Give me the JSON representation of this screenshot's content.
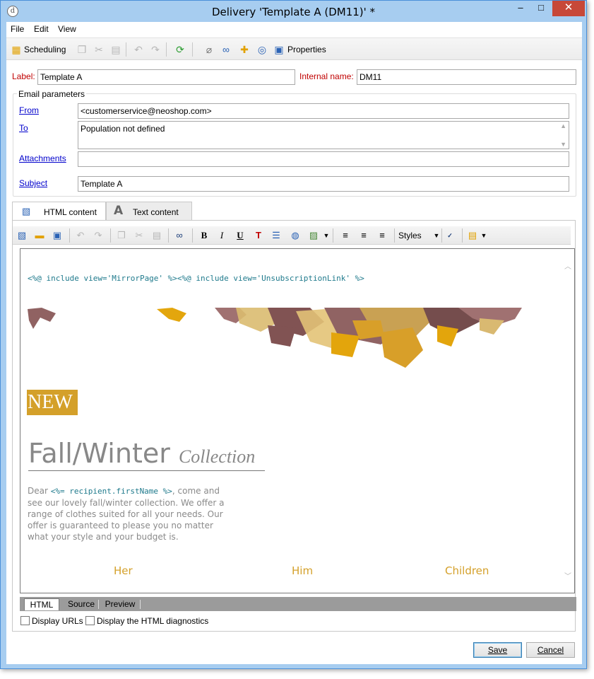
{
  "window": {
    "title": "Delivery 'Template A (DM11)' *",
    "app_icon_glyph": "d",
    "minimize_glyph": "–",
    "maximize_glyph": "□",
    "close_glyph": "✕"
  },
  "menu": {
    "items": [
      "File",
      "Edit",
      "View"
    ]
  },
  "toolbar": {
    "scheduling_label": "Scheduling",
    "properties_label": "Properties",
    "icons": [
      "calendar-icon",
      "copy-icon",
      "cut-icon",
      "paste-icon",
      "undo-icon",
      "redo-icon",
      "refresh-icon",
      "attachment-icon",
      "link-icon",
      "gift-icon",
      "target-icon",
      "clipboard-icon"
    ]
  },
  "form": {
    "label_caption": "Label:",
    "label_value": "Template A",
    "internal_name_caption": "Internal name:",
    "internal_name_value": "DM11",
    "group_title": "Email parameters",
    "from_link": "From",
    "from_value": "<customerservice@neoshop.com>",
    "to_link": "To",
    "to_value": "Population not defined",
    "attachments_link": "Attachments",
    "attachments_value": "",
    "subject_link": "Subject",
    "subject_value": "Template A"
  },
  "content_tabs": [
    {
      "label": "HTML content",
      "icon": "html-content-icon"
    },
    {
      "label": "Text content",
      "icon": "text-content-icon"
    }
  ],
  "editor": {
    "styles_label": "Styles",
    "bold_glyph": "B",
    "italic_glyph": "I",
    "underline_glyph": "U"
  },
  "email_preview": {
    "include_line": "<%@ include view='MirrorPage' %><%@ include view='UnsubscriptionLink' %>",
    "new_badge": "NEW",
    "headline_main": "Fall/Winter",
    "headline_script": "Collection",
    "body_prefix": "Dear ",
    "body_code": "<%= recipient.firstName %>",
    "body_rest": ", come and see our lovely fall/winter collection. We offer a range of clothes suited for all your needs. Our offer is guaranteed to please you no matter what your style and your budget is.",
    "nav": [
      "Her",
      "Him",
      "Children"
    ],
    "accent_color": "#d4a02a"
  },
  "view_tabs": [
    "HTML",
    "Source",
    "Preview"
  ],
  "options": {
    "display_urls": "Display URLs",
    "display_diagnostics": "Display the HTML diagnostics"
  },
  "buttons": {
    "save": "Save",
    "cancel": "Cancel"
  }
}
